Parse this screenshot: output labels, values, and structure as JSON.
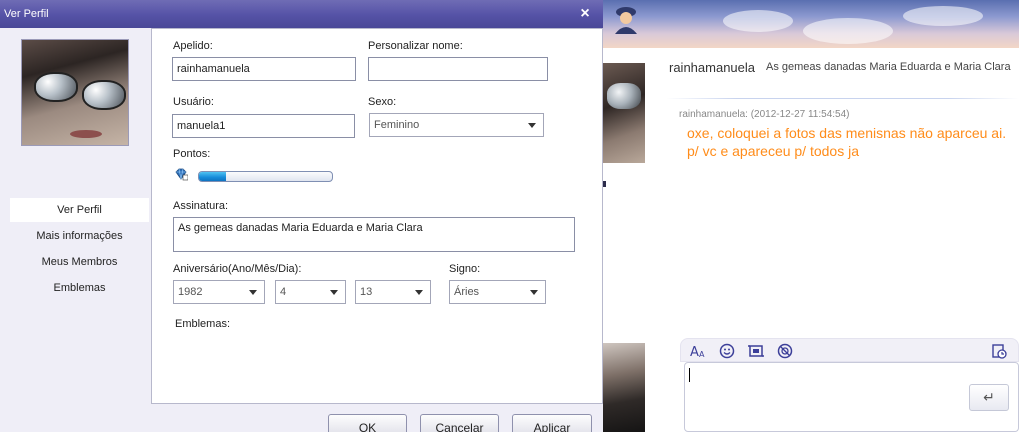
{
  "dialog": {
    "title": "Ver Perfil",
    "close_glyph": "×",
    "nav": [
      {
        "label": "Ver Perfil",
        "active": true
      },
      {
        "label": "Mais informações",
        "active": false
      },
      {
        "label": "Meus Membros",
        "active": false
      },
      {
        "label": "Emblemas",
        "active": false
      }
    ],
    "form": {
      "apelido_label": "Apelido:",
      "apelido_value": "rainhamanuela",
      "personalizar_label": "Personalizar nome:",
      "personalizar_value": "",
      "usuario_label": "Usuário:",
      "usuario_value": "manuela1",
      "sexo_label": "Sexo:",
      "sexo_value": "Feminino",
      "pontos_label": "Pontos:",
      "pontos_progress": 0.2,
      "assinatura_label": "Assinatura:",
      "assinatura_value": "As gemeas danadas Maria Eduarda e Maria Clara",
      "aniversario_label": "Aniversário(Ano/Mês/Dia):",
      "ano_value": "1982",
      "mes_value": "4",
      "dia_value": "13",
      "signo_label": "Signo:",
      "signo_value": "Áries",
      "emblemas_label": "Emblemas:"
    },
    "buttons": {
      "ok": "OK",
      "cancel": "Cancelar",
      "apply": "Aplicar"
    }
  },
  "chat": {
    "contact_name": "rainhamanuela",
    "contact_signature": "As gemeas danadas Maria Eduarda e Maria Clara",
    "message_meta": "rainhamanuela: (2012-12-27 11:54:54)",
    "message_text": "oxe, coloquei a fotos das menisnas não aparceu ai. p/ vc e apareceu p/ todos ja",
    "message_color": "#ff8c1a",
    "toolbar_icons": [
      "font-icon",
      "emoticon-icon",
      "screenshot-icon",
      "nudge-icon",
      "history-icon"
    ],
    "send_glyph": "↵"
  },
  "colors": {
    "titlebar": "#5552a6",
    "accent": "#3c3f99"
  }
}
